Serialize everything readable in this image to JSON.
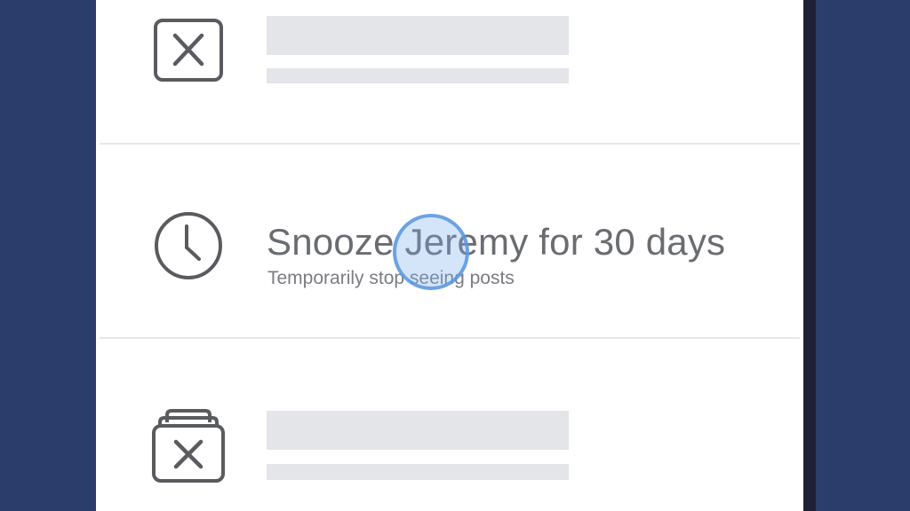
{
  "menu": {
    "items": [
      {
        "icon": "close-box-icon",
        "title": "",
        "subtitle": "",
        "placeholder": true
      },
      {
        "icon": "clock-icon",
        "title": "Snooze Jeremy for 30 days",
        "subtitle": "Temporarily stop seeing posts",
        "placeholder": false
      },
      {
        "icon": "unfollow-stack-icon",
        "title": "",
        "subtitle": "",
        "placeholder": true
      }
    ]
  },
  "colors": {
    "background": "#2b3d6b",
    "panel": "#ffffff",
    "placeholder": "#e4e5e9",
    "icon": "#5a5b5f",
    "tap_indicator": "#5a96e1"
  }
}
